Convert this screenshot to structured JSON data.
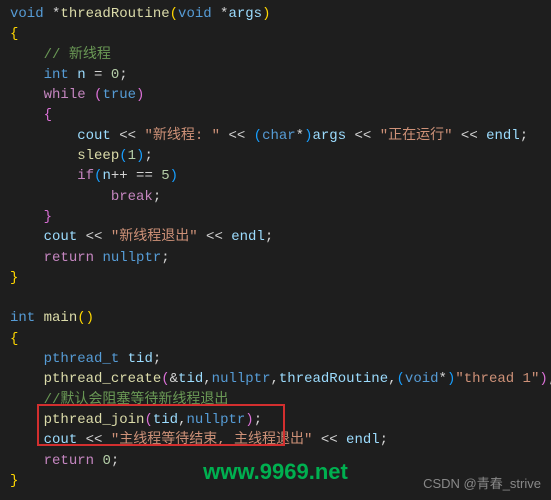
{
  "code": {
    "l1_void": "void",
    "l1_star": " *",
    "l1_fn": "threadRoutine",
    "l1_open": "(",
    "l1_void2": "void",
    "l1_star2": " *",
    "l1_arg": "args",
    "l1_close": ")",
    "l2": "{",
    "l3_pad": "    ",
    "l3": "// 新线程",
    "l4_pad": "    ",
    "l4_int": "int",
    "l4_sp": " ",
    "l4_n": "n",
    "l4_eq": " = ",
    "l4_zero": "0",
    "l4_semi": ";",
    "l5_pad": "    ",
    "l5_while": "while",
    "l5_sp": " ",
    "l5_open": "(",
    "l5_true": "true",
    "l5_close": ")",
    "l6_pad": "    ",
    "l6": "{",
    "l7_pad": "        ",
    "l7_cout": "cout",
    "l7_op1": " << ",
    "l7_str1": "\"新线程: \"",
    "l7_op2": " << ",
    "l7_cast_open": "(",
    "l7_char": "char",
    "l7_star": "*",
    "l7_cast_close": ")",
    "l7_args": "args",
    "l7_op3": " << ",
    "l7_str2": "\"正在运行\"",
    "l7_op4": " << ",
    "l7_endl": "endl",
    "l7_semi": ";",
    "l8_pad": "        ",
    "l8_sleep": "sleep",
    "l8_open": "(",
    "l8_one": "1",
    "l8_close": ")",
    "l8_semi": ";",
    "l9_pad": "        ",
    "l9_if": "if",
    "l9_open": "(",
    "l9_n": "n",
    "l9_pp": "++ == ",
    "l9_five": "5",
    "l9_close": ")",
    "l10_pad": "            ",
    "l10_break": "break",
    "l10_semi": ";",
    "l11_pad": "    ",
    "l11": "}",
    "l12_pad": "    ",
    "l12_cout": "cout",
    "l12_op1": " << ",
    "l12_str": "\"新线程退出\"",
    "l12_op2": " << ",
    "l12_endl": "endl",
    "l12_semi": ";",
    "l13_pad": "    ",
    "l13_ret": "return",
    "l13_sp": " ",
    "l13_null": "nullptr",
    "l13_semi": ";",
    "l14": "}",
    "l16_int": "int",
    "l16_sp": " ",
    "l16_main": "main",
    "l16_paren": "()",
    "l17": "{",
    "l18_pad": "    ",
    "l18_type": "pthread_t",
    "l18_sp": " ",
    "l18_tid": "tid",
    "l18_semi": ";",
    "l19_pad": "    ",
    "l19_fn": "pthread_create",
    "l19_open": "(",
    "l19_amp": "&",
    "l19_tid": "tid",
    "l19_c1": ",",
    "l19_null": "nullptr",
    "l19_c2": ",",
    "l19_tr": "threadRoutine",
    "l19_c3": ",",
    "l19_cast_open": "(",
    "l19_void": "void",
    "l19_star": "*",
    "l19_cast_close": ")",
    "l19_str": "\"thread 1\"",
    "l19_close": ")",
    "l19_semi": ";",
    "l20_pad": "    ",
    "l20": "//默认会阻塞等待新线程退出",
    "l21_pad": "    ",
    "l21_fn": "pthread_join",
    "l21_open": "(",
    "l21_tid": "tid",
    "l21_c": ",",
    "l21_null": "nullptr",
    "l21_close": ")",
    "l21_semi": ";",
    "l22_pad": "    ",
    "l22_cout": "cout",
    "l22_op1": " << ",
    "l22_str": "\"主线程等待结束, 主线程退出\"",
    "l22_op2": " << ",
    "l22_endl": "endl",
    "l22_semi": ";",
    "l23_pad": "    ",
    "l23_ret": "return",
    "l23_sp": " ",
    "l23_zero": "0",
    "l23_semi": ";",
    "l24": "}"
  },
  "watermarks": {
    "green": "www.9969.net",
    "csdn": "CSDN @青春_strive"
  }
}
